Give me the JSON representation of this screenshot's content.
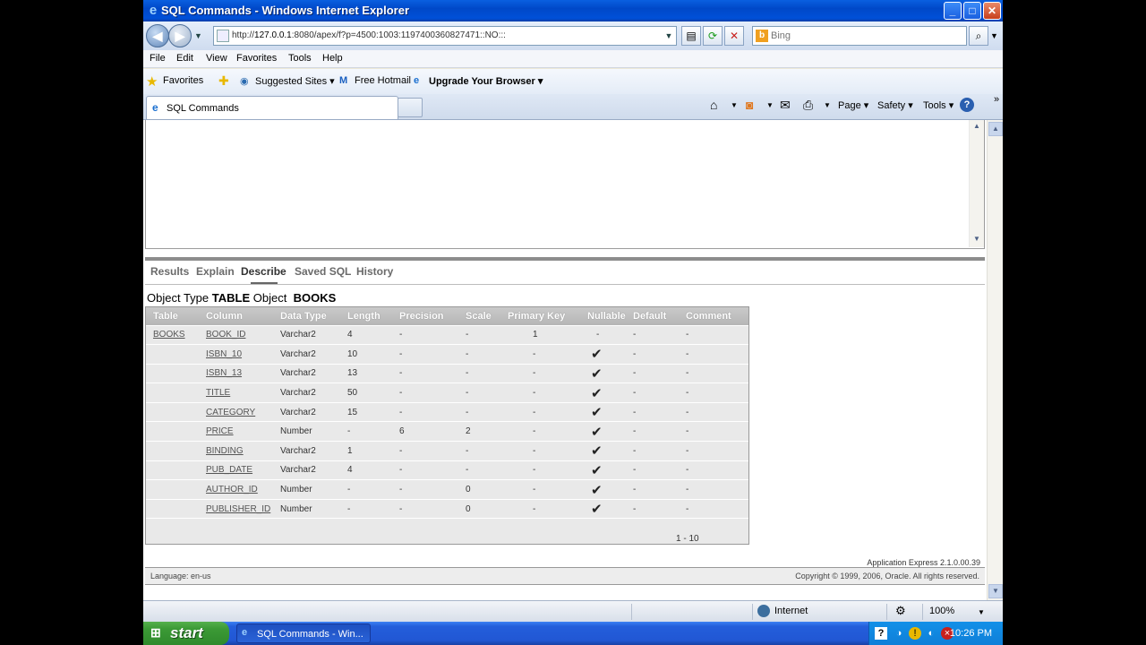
{
  "window": {
    "title": "SQL Commands - Windows Internet Explorer",
    "minimize": "_",
    "maximize": "□",
    "close": "✕"
  },
  "address": {
    "url_prefix": "http://",
    "url_host": "127.0.0.1",
    "url_rest": ":8080/apex/f?p=4500:1003:1197400360827471::NO:::",
    "search_placeholder": "Bing"
  },
  "menu": [
    "File",
    "Edit",
    "View",
    "Favorites",
    "Tools",
    "Help"
  ],
  "favorites": {
    "favorites_label": "Favorites",
    "suggested": "Suggested Sites ▾",
    "hotmail": "Free Hotmail",
    "upgrade": "Upgrade Your Browser ▾"
  },
  "tab": {
    "label": "SQL Commands"
  },
  "commands": {
    "page": "Page ▾",
    "safety": "Safety ▾",
    "tools": "Tools ▾",
    "help": "?",
    "more": "»"
  },
  "subtabs": [
    "Results",
    "Explain",
    "Describe",
    "Saved SQL",
    "History"
  ],
  "active_subtab": "Describe",
  "object": {
    "type_label": "Object Type",
    "type_value": "TABLE",
    "object_label": "Object",
    "object_value": "BOOKS"
  },
  "describe": {
    "headers": [
      "Table",
      "Column",
      "Data Type",
      "Length",
      "Precision",
      "Scale",
      "Primary Key",
      "Nullable",
      "Default",
      "Comment"
    ],
    "rows": [
      {
        "table": "BOOKS",
        "column": "BOOK_ID",
        "type": "Varchar2",
        "length": "4",
        "precision": "-",
        "scale": "-",
        "pk": "1",
        "nullable": "-",
        "default": "-",
        "comment": "-"
      },
      {
        "table": "",
        "column": "ISBN_10",
        "type": "Varchar2",
        "length": "10",
        "precision": "-",
        "scale": "-",
        "pk": "-",
        "nullable": "✔",
        "default": "-",
        "comment": "-"
      },
      {
        "table": "",
        "column": "ISBN_13",
        "type": "Varchar2",
        "length": "13",
        "precision": "-",
        "scale": "-",
        "pk": "-",
        "nullable": "✔",
        "default": "-",
        "comment": "-"
      },
      {
        "table": "",
        "column": "TITLE",
        "type": "Varchar2",
        "length": "50",
        "precision": "-",
        "scale": "-",
        "pk": "-",
        "nullable": "✔",
        "default": "-",
        "comment": "-"
      },
      {
        "table": "",
        "column": "CATEGORY",
        "type": "Varchar2",
        "length": "15",
        "precision": "-",
        "scale": "-",
        "pk": "-",
        "nullable": "✔",
        "default": "-",
        "comment": "-"
      },
      {
        "table": "",
        "column": "PRICE",
        "type": "Number",
        "length": "-",
        "precision": "6",
        "scale": "2",
        "pk": "-",
        "nullable": "✔",
        "default": "-",
        "comment": "-"
      },
      {
        "table": "",
        "column": "BINDING",
        "type": "Varchar2",
        "length": "1",
        "precision": "-",
        "scale": "-",
        "pk": "-",
        "nullable": "✔",
        "default": "-",
        "comment": "-"
      },
      {
        "table": "",
        "column": "PUB_DATE",
        "type": "Varchar2",
        "length": "4",
        "precision": "-",
        "scale": "-",
        "pk": "-",
        "nullable": "✔",
        "default": "-",
        "comment": "-"
      },
      {
        "table": "",
        "column": "AUTHOR_ID",
        "type": "Number",
        "length": "-",
        "precision": "-",
        "scale": "0",
        "pk": "-",
        "nullable": "✔",
        "default": "-",
        "comment": "-"
      },
      {
        "table": "",
        "column": "PUBLISHER_ID",
        "type": "Number",
        "length": "-",
        "precision": "-",
        "scale": "0",
        "pk": "-",
        "nullable": "✔",
        "default": "-",
        "comment": "-"
      }
    ],
    "pager": "1 - 10"
  },
  "footer": {
    "version": "Application Express 2.1.0.00.39",
    "language": "Language: en-us",
    "copyright": "Copyright © 1999, 2006, Oracle. All rights reserved."
  },
  "status": {
    "zone": "Internet",
    "zoom": "100%"
  },
  "taskbar": {
    "start": "start",
    "task": "SQL Commands - Win...",
    "time": "10:26 PM"
  },
  "colors": {
    "titlebar": "#0050d8",
    "taskbar": "#245edb",
    "start": "#3c9a36",
    "table_header": "#bdbdbd",
    "table_body": "#e9e9e9"
  }
}
